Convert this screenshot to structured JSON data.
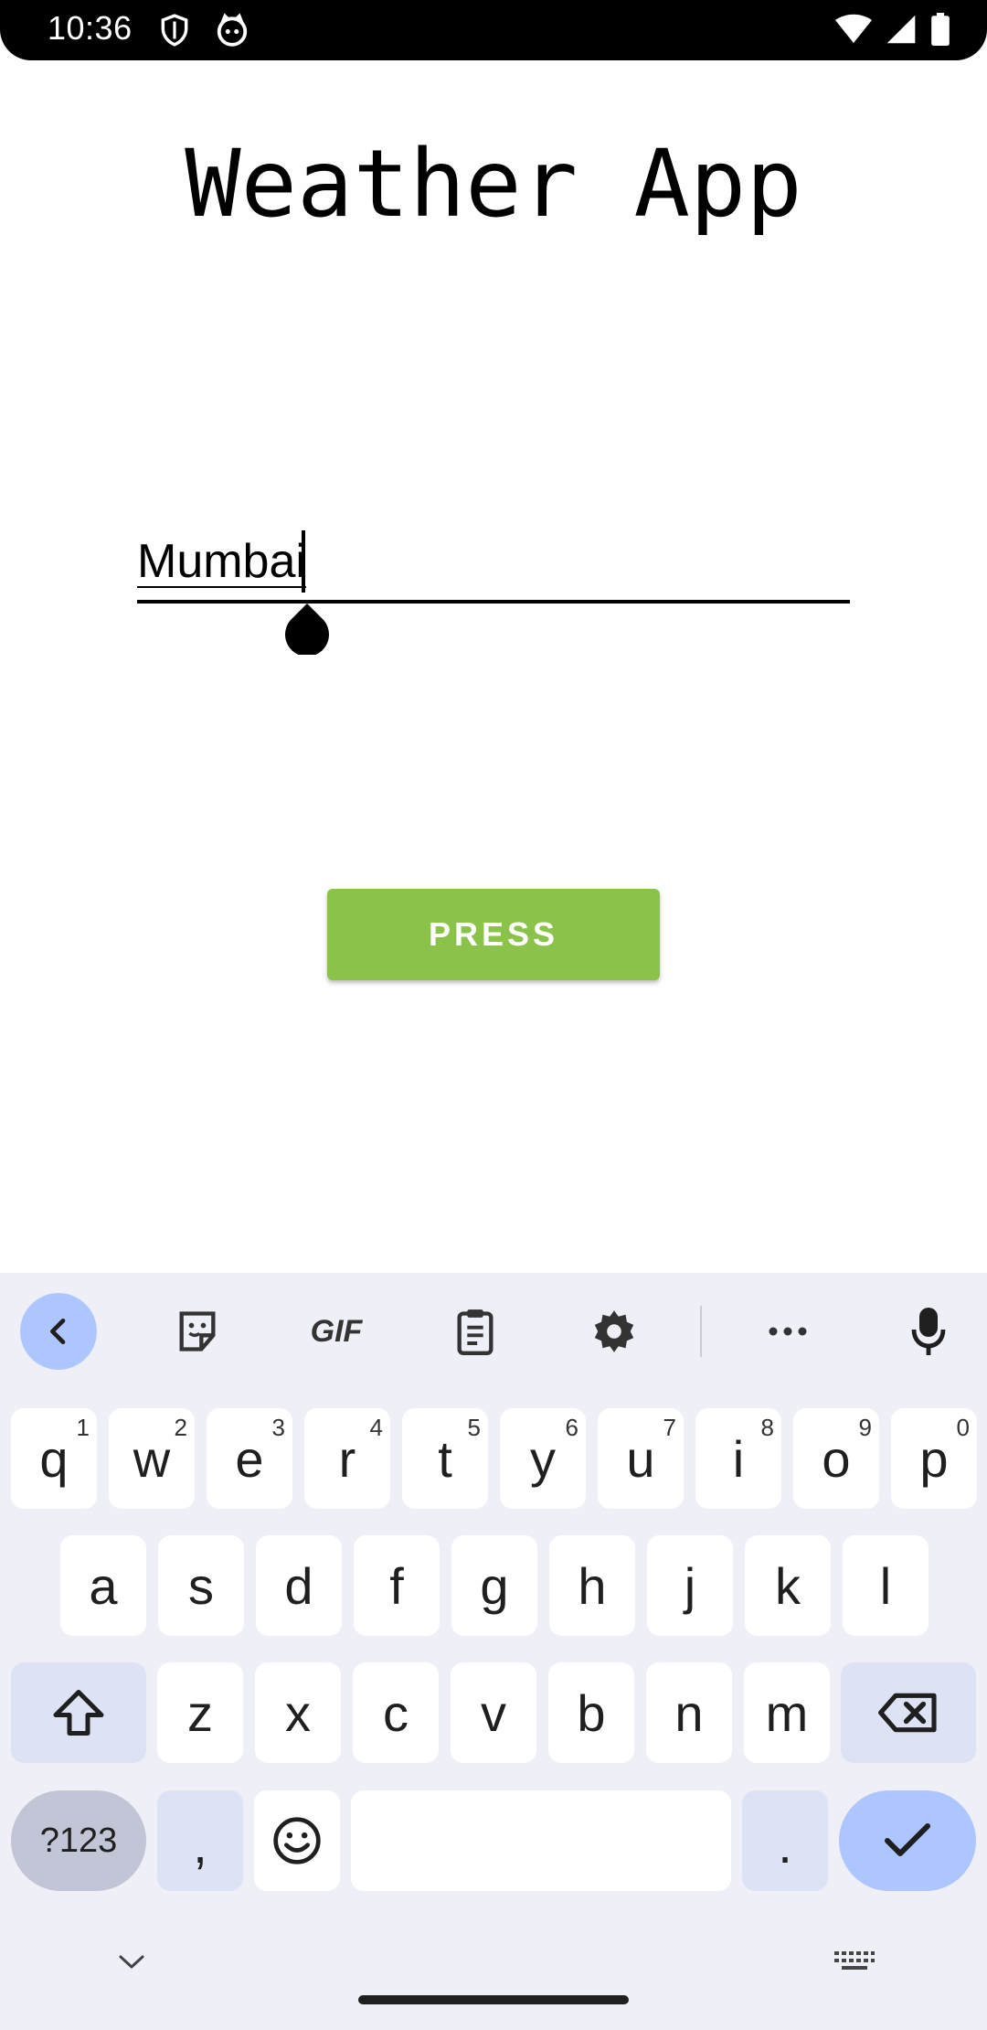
{
  "status_bar": {
    "time": "10:36",
    "icons_left": [
      "shield-icon",
      "cat-icon"
    ],
    "icons_right": [
      "wifi-icon",
      "signal-icon",
      "battery-icon"
    ]
  },
  "app": {
    "title": "Weather App",
    "city_input": {
      "value": "Mumbai"
    },
    "button_label": "PRESS",
    "button_color": "#8bc34a"
  },
  "keyboard": {
    "toolbar": [
      "back-icon",
      "sticker-icon",
      "gif-icon",
      "clipboard-icon",
      "gear-icon",
      "more-icon",
      "microphone-icon"
    ],
    "gif_label": "GIF",
    "row1": [
      {
        "k": "q",
        "n": "1"
      },
      {
        "k": "w",
        "n": "2"
      },
      {
        "k": "e",
        "n": "3"
      },
      {
        "k": "r",
        "n": "4"
      },
      {
        "k": "t",
        "n": "5"
      },
      {
        "k": "y",
        "n": "6"
      },
      {
        "k": "u",
        "n": "7"
      },
      {
        "k": "i",
        "n": "8"
      },
      {
        "k": "o",
        "n": "9"
      },
      {
        "k": "p",
        "n": "0"
      }
    ],
    "row2": [
      "a",
      "s",
      "d",
      "f",
      "g",
      "h",
      "j",
      "k",
      "l"
    ],
    "row3": [
      "z",
      "x",
      "c",
      "v",
      "b",
      "n",
      "m"
    ],
    "symbols_label": "?123",
    "comma": ",",
    "period": "."
  }
}
